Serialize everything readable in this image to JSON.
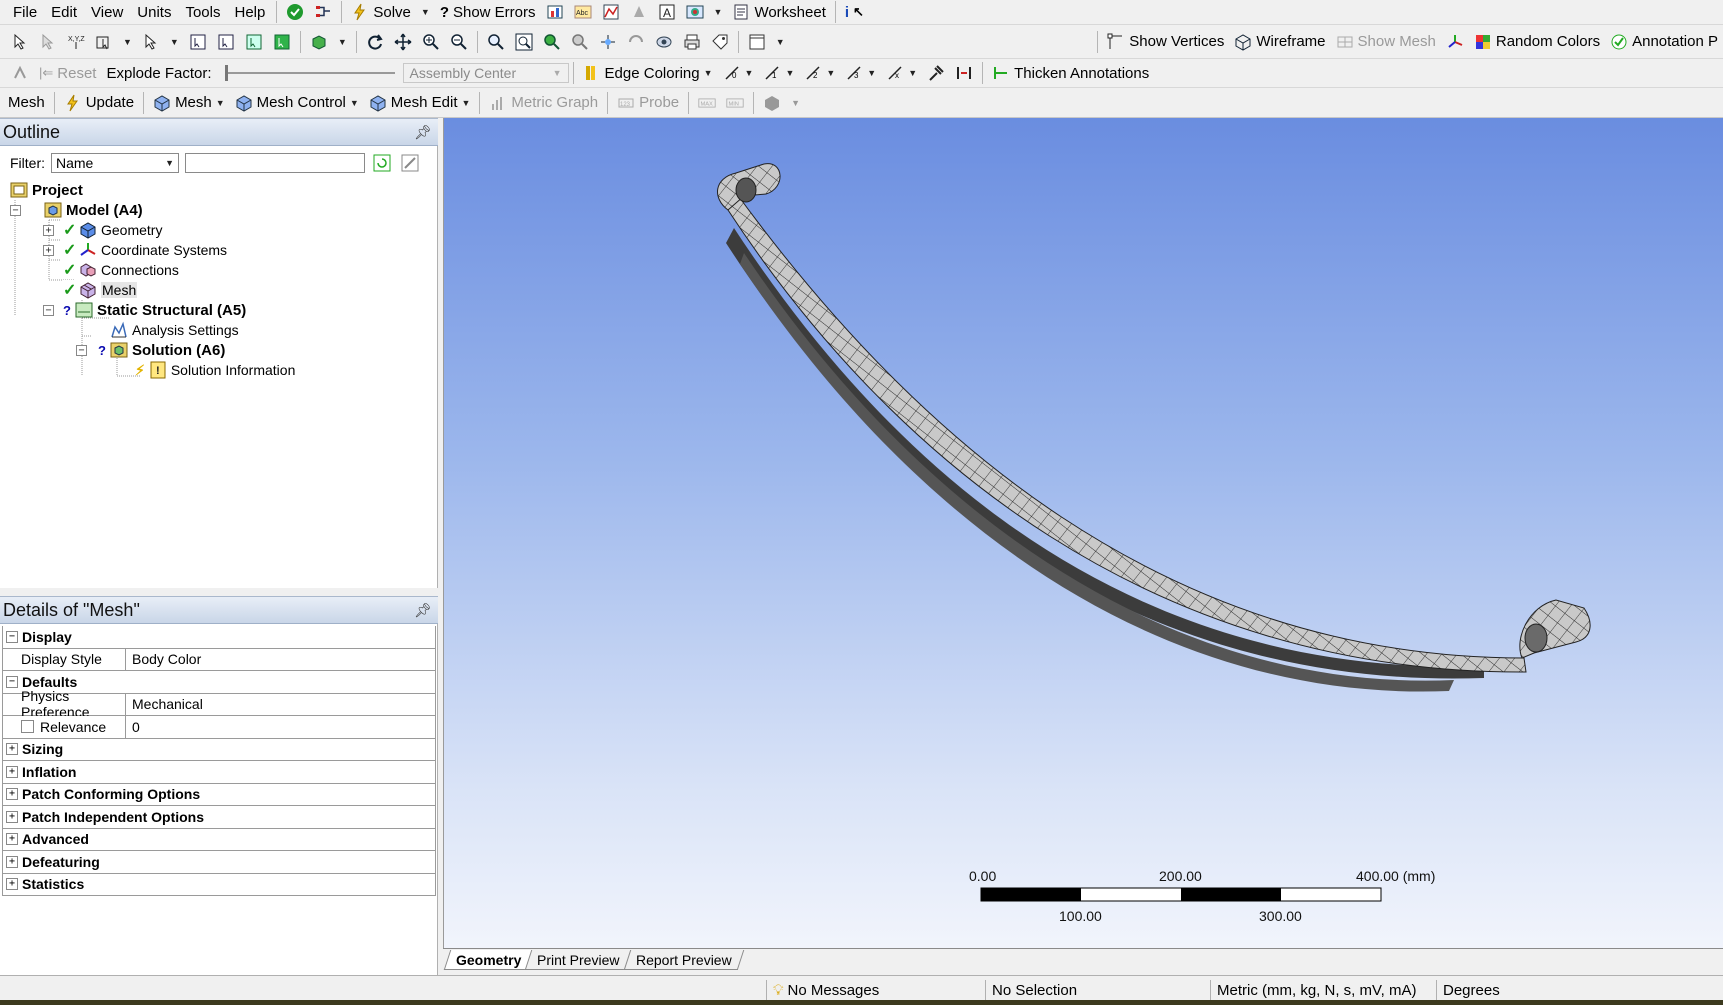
{
  "menu": [
    "File",
    "Edit",
    "View",
    "Units",
    "Tools",
    "Help"
  ],
  "toolbar1": {
    "solve": "Solve",
    "show_errors": "Show Errors",
    "worksheet": "Worksheet"
  },
  "toolbar2": {
    "show_vertices": "Show Vertices",
    "wireframe": "Wireframe",
    "show_mesh": "Show Mesh",
    "random_colors": "Random Colors",
    "annotation_prefs": "Annotation P"
  },
  "toolbar3": {
    "reset": "Reset",
    "explode_factor": "Explode Factor:",
    "assembly_center": "Assembly Center",
    "edge_coloring": "Edge Coloring",
    "thicken_annotations": "Thicken Annotations"
  },
  "toolbar4": {
    "mesh": "Mesh",
    "update": "Update",
    "mesh_menu": "Mesh",
    "mesh_control": "Mesh Control",
    "mesh_edit": "Mesh Edit",
    "metric_graph": "Metric Graph",
    "probe": "Probe"
  },
  "outline": {
    "title": "Outline",
    "filter_label": "Filter:",
    "filter_value": "Name",
    "tree": {
      "project": "Project",
      "model": "Model (A4)",
      "geometry": "Geometry",
      "coordinate_systems": "Coordinate Systems",
      "connections": "Connections",
      "mesh": "Mesh",
      "static_structural": "Static Structural (A5)",
      "analysis_settings": "Analysis Settings",
      "solution": "Solution (A6)",
      "solution_information": "Solution Information"
    }
  },
  "details": {
    "title": "Details of \"Mesh\"",
    "rows": {
      "display": "Display",
      "display_style_key": "Display Style",
      "display_style_val": "Body Color",
      "defaults": "Defaults",
      "physics_pref_key": "Physics Preference",
      "physics_pref_val": "Mechanical",
      "relevance_key": "Relevance",
      "relevance_val": "0",
      "sizing": "Sizing",
      "inflation": "Inflation",
      "patch_conforming": "Patch Conforming Options",
      "patch_independent": "Patch Independent Options",
      "advanced": "Advanced",
      "defeaturing": "Defeaturing",
      "statistics": "Statistics"
    }
  },
  "scale_bar": {
    "top_labels": [
      "0.00",
      "200.00",
      "400.00 (mm)"
    ],
    "bottom_labels": [
      "100.00",
      "300.00"
    ]
  },
  "tabs": [
    "Geometry",
    "Print Preview",
    "Report Preview"
  ],
  "status": {
    "messages": "No Messages",
    "selection": "No Selection",
    "units": "Metric (mm, kg, N, s, mV, mA)",
    "angle": "Degrees"
  }
}
